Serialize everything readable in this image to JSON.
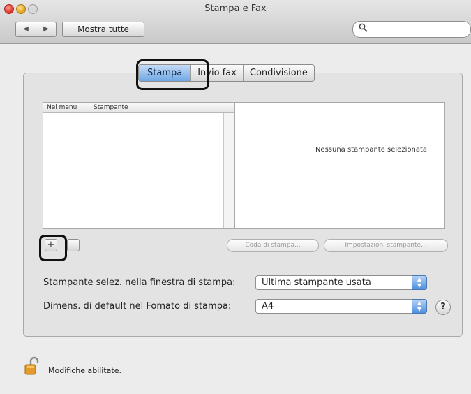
{
  "window": {
    "title": "Stampa e Fax",
    "nav_back": "◀",
    "nav_forward": "▶",
    "show_all_label": "Mostra tutte",
    "search_icon": "magnifier-icon"
  },
  "tabs": [
    {
      "label": "Stampa",
      "active": true
    },
    {
      "label": "Invio fax",
      "active": false
    },
    {
      "label": "Condivisione",
      "active": false
    }
  ],
  "printer_list": {
    "columns": [
      "Nel menu",
      "Stampante"
    ],
    "rows": []
  },
  "detail": {
    "empty_text": "Nessuna stampante selezionata"
  },
  "list_buttons": {
    "add": "+",
    "remove": "-"
  },
  "actions": {
    "queue_label": "Coda di stampa...",
    "setup_label": "Impostazioni stampante..."
  },
  "settings": {
    "selected_printer_label": "Stampante selez. nella finestra di stampa:",
    "selected_printer_value": "Ultima stampante usata",
    "paper_size_label": "Dimens. di default nel Fomato di stampa:",
    "paper_size_value": "A4",
    "help": "?"
  },
  "footer": {
    "lock_text": "Modifiche abilitate.",
    "lock_icon": "unlocked-padlock-icon"
  },
  "colors": {
    "active_tab": "#6fa7e4",
    "popup_arrow": "#4f8fdc",
    "lock_body": "#e39a2a",
    "highlight_outline": "#111111"
  }
}
